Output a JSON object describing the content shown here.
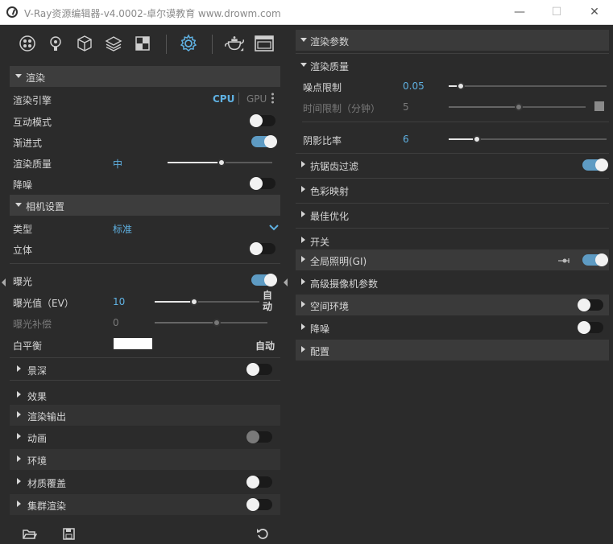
{
  "window": {
    "title": "V-Ray资源编辑器-v4.0002-卓尔谟教育 www.drowm.com",
    "minimize": "—",
    "maximize": "☐",
    "close": "✕"
  },
  "toolbar": {
    "icons": [
      "materials-icon",
      "lights-icon",
      "geometry-icon",
      "layers-icon",
      "textures-icon",
      "settings-icon",
      "render-teapot-icon",
      "frame-buffer-icon"
    ]
  },
  "left": {
    "render": {
      "title": "渲染",
      "engine_label": "渲染引擎",
      "engine_cpu": "CPU",
      "engine_gpu": "GPU",
      "interactive_label": "互动模式",
      "interactive_on": false,
      "progressive_label": "渐进式",
      "progressive_on": true,
      "quality_label": "渲染质量",
      "quality_value": "中",
      "denoise_label": "降噪",
      "denoise_on": false
    },
    "camera": {
      "title": "相机设置",
      "type_label": "类型",
      "type_value": "标准",
      "stereo_label": "立体",
      "stereo_on": false,
      "exposure_label": "曝光",
      "exposure_on": true,
      "ev_label": "曝光值（EV）",
      "ev_value": "10",
      "ev_auto": "自动",
      "comp_label": "曝光补偿",
      "comp_value": "0",
      "wb_label": "白平衡",
      "wb_auto": "自动",
      "wb_color": "#ffffff",
      "dof_label": "景深",
      "dof_on": false,
      "effects_label": "效果"
    },
    "sections": {
      "render_output": "渲染输出",
      "animation": "动画",
      "environment": "环境",
      "material_override": "材质覆盖",
      "swarm": "集群渲染"
    }
  },
  "right": {
    "render_params": "渲染参数",
    "render_quality": "渲染质量",
    "noise_label": "噪点限制",
    "noise_value": "0.05",
    "time_label": "时间限制（分钟）",
    "time_value": "5",
    "shading_label": "阴影比率",
    "shading_value": "6",
    "antialias": "抗锯齿过滤",
    "color_mapping": "色彩映射",
    "optimization": "最佳优化",
    "switches": "开关",
    "gi": "全局照明(GI)",
    "advanced_camera": "高级摄像机参数",
    "volumetric": "空间环境",
    "denoiser": "降噪",
    "config": "配置"
  },
  "colors": {
    "accent": "#5fb1e2",
    "toggle_on": "#5e9bc3",
    "panel": "#2b2b2b",
    "header": "#3d3d3d"
  }
}
